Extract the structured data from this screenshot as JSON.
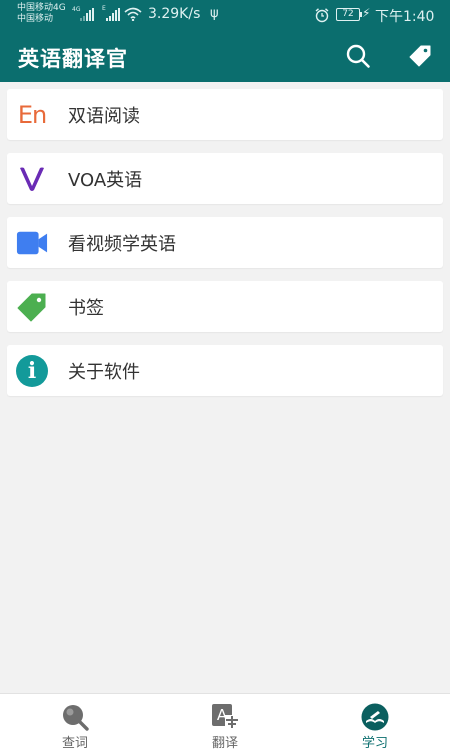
{
  "status_bar": {
    "carrier_1": "中国移动4G",
    "network_1": "4G",
    "carrier_2": "中国移动",
    "network_2": "E",
    "speed": "3.29K/s",
    "usb_symbol": "ψ",
    "battery": "72",
    "charging_symbol": "⚡",
    "time": "下午1:40"
  },
  "app_bar": {
    "title": "英语翻译官",
    "actions": [
      "search-icon",
      "tag-icon"
    ]
  },
  "menu": {
    "items": [
      {
        "label": "双语阅读",
        "icon": "en-logo-icon",
        "icon_text": "En",
        "color": "#e86a3a"
      },
      {
        "label": "VOA英语",
        "icon": "voa-logo-icon",
        "color": "#6a2bb5"
      },
      {
        "label": "看视频学英语",
        "icon": "video-camera-icon",
        "color": "#3f7ef0"
      },
      {
        "label": "书签",
        "icon": "bookmark-tag-icon",
        "color": "#4caf50"
      },
      {
        "label": "关于软件",
        "icon": "info-icon",
        "icon_text": "i",
        "color": "#139a9a"
      }
    ]
  },
  "bottom_nav": {
    "tabs": [
      {
        "label": "查词",
        "icon": "lookup-magnifier-icon",
        "active": false
      },
      {
        "label": "翻译",
        "icon": "translate-icon",
        "icon_text": "A",
        "active": false
      },
      {
        "label": "学习",
        "icon": "study-book-icon",
        "active": true
      }
    ]
  },
  "colors": {
    "primary": "#0b6e6e",
    "background": "#f2f2f2",
    "card": "#ffffff"
  }
}
